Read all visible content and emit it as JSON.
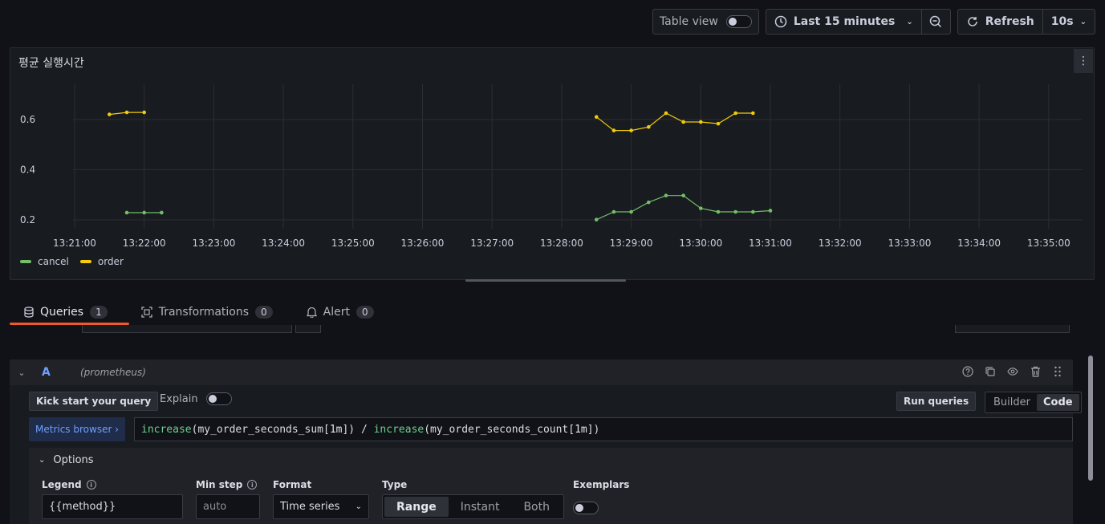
{
  "toolbar": {
    "table_view": "Table view",
    "time_range": "Last 15 minutes",
    "refresh": "Refresh",
    "interval": "10s"
  },
  "panel": {
    "title": "평균 실행시간"
  },
  "chart_data": {
    "type": "line",
    "title": "평균 실행시간",
    "x_ticks": [
      "13:21:00",
      "13:22:00",
      "13:23:00",
      "13:24:00",
      "13:25:00",
      "13:26:00",
      "13:27:00",
      "13:28:00",
      "13:29:00",
      "13:30:00",
      "13:31:00",
      "13:32:00",
      "13:33:00",
      "13:34:00",
      "13:35:00"
    ],
    "y_ticks": [
      "0.2",
      "0.4",
      "0.6"
    ],
    "ylim": [
      0.165,
      0.74
    ],
    "grid": true,
    "legend_position": "bottom-left",
    "series": [
      {
        "name": "cancel",
        "color": "#73bf69",
        "points": [
          [
            [
              "13:21:45",
              0.229
            ],
            [
              "13:22:00",
              0.229
            ],
            [
              "13:22:15",
              0.229
            ]
          ],
          [
            [
              "13:28:30",
              0.201
            ],
            [
              "13:28:45",
              0.232
            ],
            [
              "13:29:00",
              0.232
            ],
            [
              "13:29:15",
              0.27
            ],
            [
              "13:29:30",
              0.297
            ],
            [
              "13:29:45",
              0.297
            ],
            [
              "13:30:00",
              0.246
            ],
            [
              "13:30:15",
              0.232
            ],
            [
              "13:30:30",
              0.232
            ],
            [
              "13:30:45",
              0.232
            ],
            [
              "13:31:00",
              0.237
            ]
          ]
        ]
      },
      {
        "name": "order",
        "color": "#f2cc0c",
        "points": [
          [
            [
              "13:21:30",
              0.62
            ],
            [
              "13:21:45",
              0.628
            ],
            [
              "13:22:00",
              0.628
            ]
          ],
          [
            [
              "13:28:30",
              0.61
            ],
            [
              "13:28:45",
              0.556
            ],
            [
              "13:29:00",
              0.556
            ],
            [
              "13:29:15",
              0.57
            ],
            [
              "13:29:30",
              0.625
            ],
            [
              "13:29:45",
              0.59
            ],
            [
              "13:30:00",
              0.59
            ],
            [
              "13:30:15",
              0.583
            ],
            [
              "13:30:30",
              0.625
            ],
            [
              "13:30:45",
              0.625
            ]
          ]
        ]
      }
    ]
  },
  "tabs": [
    {
      "label": "Queries",
      "count": "1"
    },
    {
      "label": "Transformations",
      "count": "0"
    },
    {
      "label": "Alert",
      "count": "0"
    }
  ],
  "query": {
    "letter": "A",
    "datasource": "(prometheus)",
    "kick_start": "Kick start your query",
    "explain": "Explain",
    "run_queries": "Run queries",
    "mode_builder": "Builder",
    "mode_code": "Code",
    "metrics_browser": "Metrics browser ›",
    "expr_fn1": "increase",
    "expr_part1": "(my_order_seconds_sum[",
    "expr_dur1": "1m",
    "expr_part2": "]) / ",
    "expr_fn2": "increase",
    "expr_part3": "(my_order_seconds_count[",
    "expr_dur2": "1m",
    "expr_part4": "])"
  },
  "options": {
    "header": "Options",
    "legend_label": "Legend",
    "legend_value": "{{method}}",
    "min_step_label": "Min step",
    "min_step_placeholder": "auto",
    "format_label": "Format",
    "format_value": "Time series",
    "type_label": "Type",
    "type_range": "Range",
    "type_instant": "Instant",
    "type_both": "Both",
    "exemplars_label": "Exemplars"
  }
}
